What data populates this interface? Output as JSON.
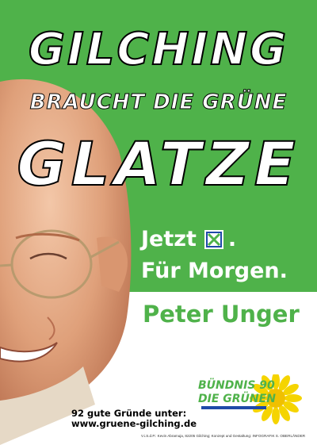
{
  "headline": {
    "line1": "GILCHING",
    "line2": "BRAUCHT DIE GRÜNE",
    "line3": "GLATZE"
  },
  "slogan": {
    "line1": "Jetzt",
    "line1_end": ".",
    "line2": "Für Morgen."
  },
  "candidate": "Peter Unger",
  "footer": {
    "reasons": "92 gute Gründe unter:",
    "url": "www.gruene-gilching.de",
    "imprint": "V.i.S.d.P.: Kevin Abramuja, 82205 Gilching; Konzept und Gestaltung: INFOGRAFIK S. OBERLÄNDER"
  },
  "logo": {
    "line1": "BÜNDNIS 90",
    "line2": "DIE GRÜNEN"
  },
  "colors": {
    "green": "#4fb24a",
    "ballot_blue": "#1f4aa8",
    "sunflower": "#f5d400"
  },
  "icons": [
    "ballot-cross-icon",
    "sunflower-icon"
  ]
}
